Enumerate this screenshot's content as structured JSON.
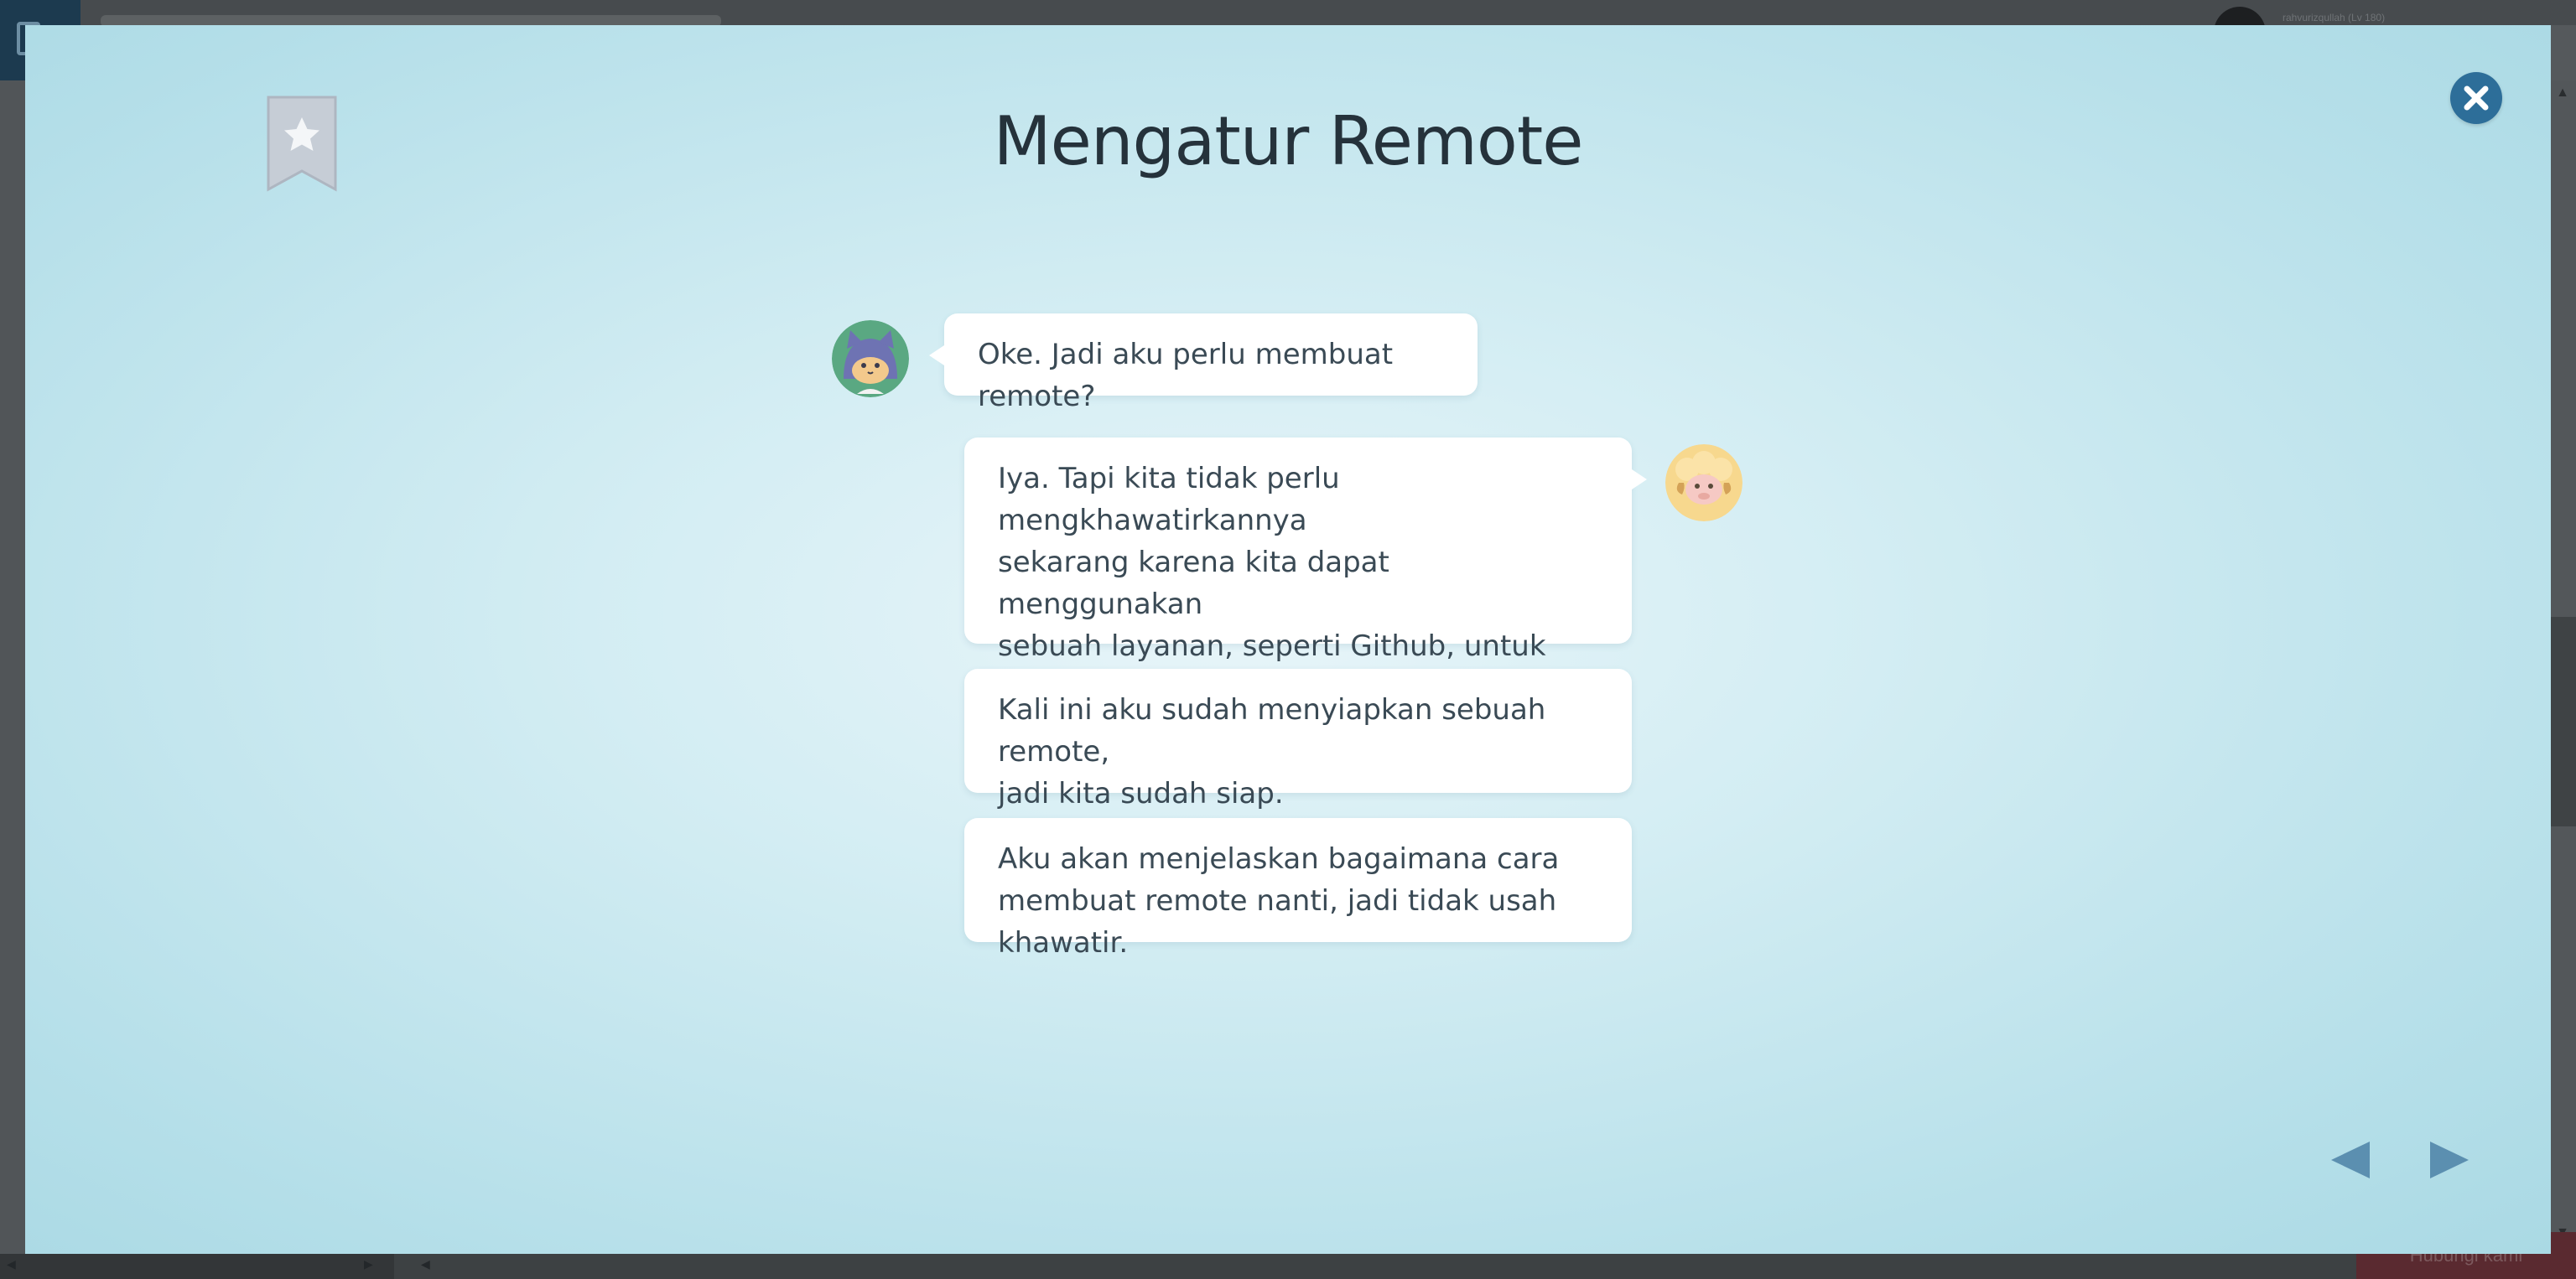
{
  "background": {
    "username": "rahvurizqullah (Lv 180)",
    "help_label": "Hubungi kami"
  },
  "modal": {
    "title": "Mengatur Remote",
    "close_icon": "close-icon",
    "bookmark_icon": "bookmark-star-icon",
    "messages": [
      {
        "speaker": "cat",
        "text": "Oke. Jadi aku perlu membuat remote?"
      },
      {
        "speaker": "sheep",
        "text": "Iya. Tapi kita tidak perlu mengkhawatirkannya\nsekarang karena kita dapat menggunakan\nsebuah layanan, seperti Github,  untuk\nmembuatnya dengan mudah."
      },
      {
        "speaker": "sheep",
        "text": "Kali ini aku sudah menyiapkan sebuah remote,\njadi kita sudah siap."
      },
      {
        "speaker": "sheep",
        "text": "Aku akan menjelaskan bagaimana cara\nmembuat remote nanti, jadi tidak usah khawatir."
      }
    ],
    "nav": {
      "prev_icon": "triangle-left-icon",
      "next_icon": "triangle-right-icon"
    },
    "colors": {
      "accent": "#2d6e99",
      "title": "#25323b",
      "bubble_text": "#3a4a55",
      "nav_arrow": "#5b8fb0"
    }
  }
}
